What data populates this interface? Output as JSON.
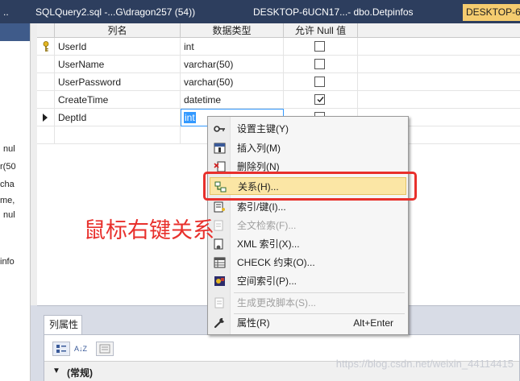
{
  "tabs": [
    {
      "label": ".."
    },
    {
      "label": "SQLQuery2.sql -...G\\dragon257 (54))"
    },
    {
      "label": "DESKTOP-6UCN17...- dbo.Detpinfos"
    },
    {
      "label": "DESKTOP-6"
    }
  ],
  "left_panel": {
    "lines": [
      "nul",
      "r(50",
      "cha",
      "me,",
      "nul",
      "info"
    ]
  },
  "grid": {
    "headers": [
      "列名",
      "数据类型",
      "允许 Null 值"
    ],
    "rows": [
      {
        "name": "UserId",
        "type": "int",
        "nullable": false,
        "primary_key": true
      },
      {
        "name": "UserName",
        "type": "varchar(50)",
        "nullable": false
      },
      {
        "name": "UserPassword",
        "type": "varchar(50)",
        "nullable": false
      },
      {
        "name": "CreateTime",
        "type": "datetime",
        "nullable": true
      },
      {
        "name": "DeptId",
        "type": "int",
        "nullable": false,
        "current": true
      }
    ]
  },
  "context_menu": {
    "items": [
      {
        "label": "设置主键(Y)",
        "icon": "key-icon"
      },
      {
        "label": "插入列(M)",
        "icon": "insert-column-icon"
      },
      {
        "label": "删除列(N)",
        "icon": "delete-column-icon"
      },
      {
        "label": "关系(H)...",
        "icon": "relationship-icon",
        "highlighted": true
      },
      {
        "label": "索引/键(I)...",
        "icon": "index-key-icon"
      },
      {
        "label": "全文检索(F)...",
        "icon": "fulltext-icon",
        "disabled": true
      },
      {
        "label": "XML 索引(X)...",
        "icon": "xml-index-icon"
      },
      {
        "label": "CHECK 约束(O)...",
        "icon": "check-constraint-icon"
      },
      {
        "label": "空间索引(P)...",
        "icon": "spatial-index-icon"
      },
      {
        "label": "生成更改脚本(S)...",
        "icon": "generate-script-icon",
        "disabled": true
      },
      {
        "label": "属性(R)",
        "shortcut": "Alt+Enter",
        "icon": "wrench-icon"
      }
    ]
  },
  "annotation": "鼠标右键关系",
  "properties": {
    "tab_label": "列属性",
    "group_label": "(常规)",
    "sort_glyph": "A↓Z"
  },
  "watermark": "https://blog.csdn.net/weixin_44114415",
  "colors": {
    "tab_strip": "#2d3e5e",
    "active_tab": "#f5cc6f",
    "menu_highlight": "#fbe6a5",
    "annotation_red": "#e8302c",
    "selection_blue": "#3399ff"
  }
}
